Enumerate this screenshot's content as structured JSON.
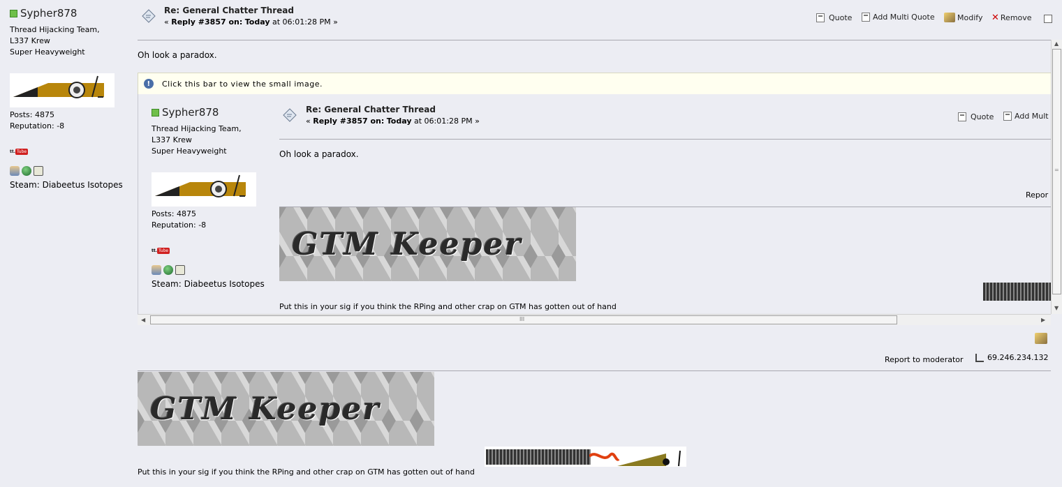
{
  "poster": {
    "username": "Sypher878",
    "title_line1": "Thread Hijacking Team,",
    "title_line2": "L337 Krew",
    "title_line3": "Super Heavyweight",
    "posts": "Posts: 4875",
    "reputation": "Reputation: -8",
    "youtube_icon": "youtube-icon",
    "steam": "Steam: Diabeetus Isotopes"
  },
  "post": {
    "title": "Re: General Chatter Thread",
    "sub_prefix": "«",
    "sub_reply": "Reply #3857 on:",
    "sub_date": "Today",
    "sub_time": "at 06:01:28 PM",
    "sub_suffix": "»",
    "body": "Oh look a paradox.",
    "actions": {
      "quote": "Quote",
      "multi_quote": "Add Multi Quote",
      "multi_quote_cut": "Add Mult",
      "modify": "Modify",
      "remove": "Remove"
    },
    "report_cut": "Repor",
    "report": "Report to moderator",
    "ip": "69.246.234.132",
    "signature_text": "Put this in your sig if you think the RPing and other crap on GTM has gotten out of hand",
    "sig_banner_text": "GTM Keeper"
  },
  "notice": {
    "icon": "info-icon",
    "text": "Click this bar to view the small image."
  },
  "scrollbars": {
    "h_thumb_label": "III",
    "v_thumb_label": "="
  }
}
